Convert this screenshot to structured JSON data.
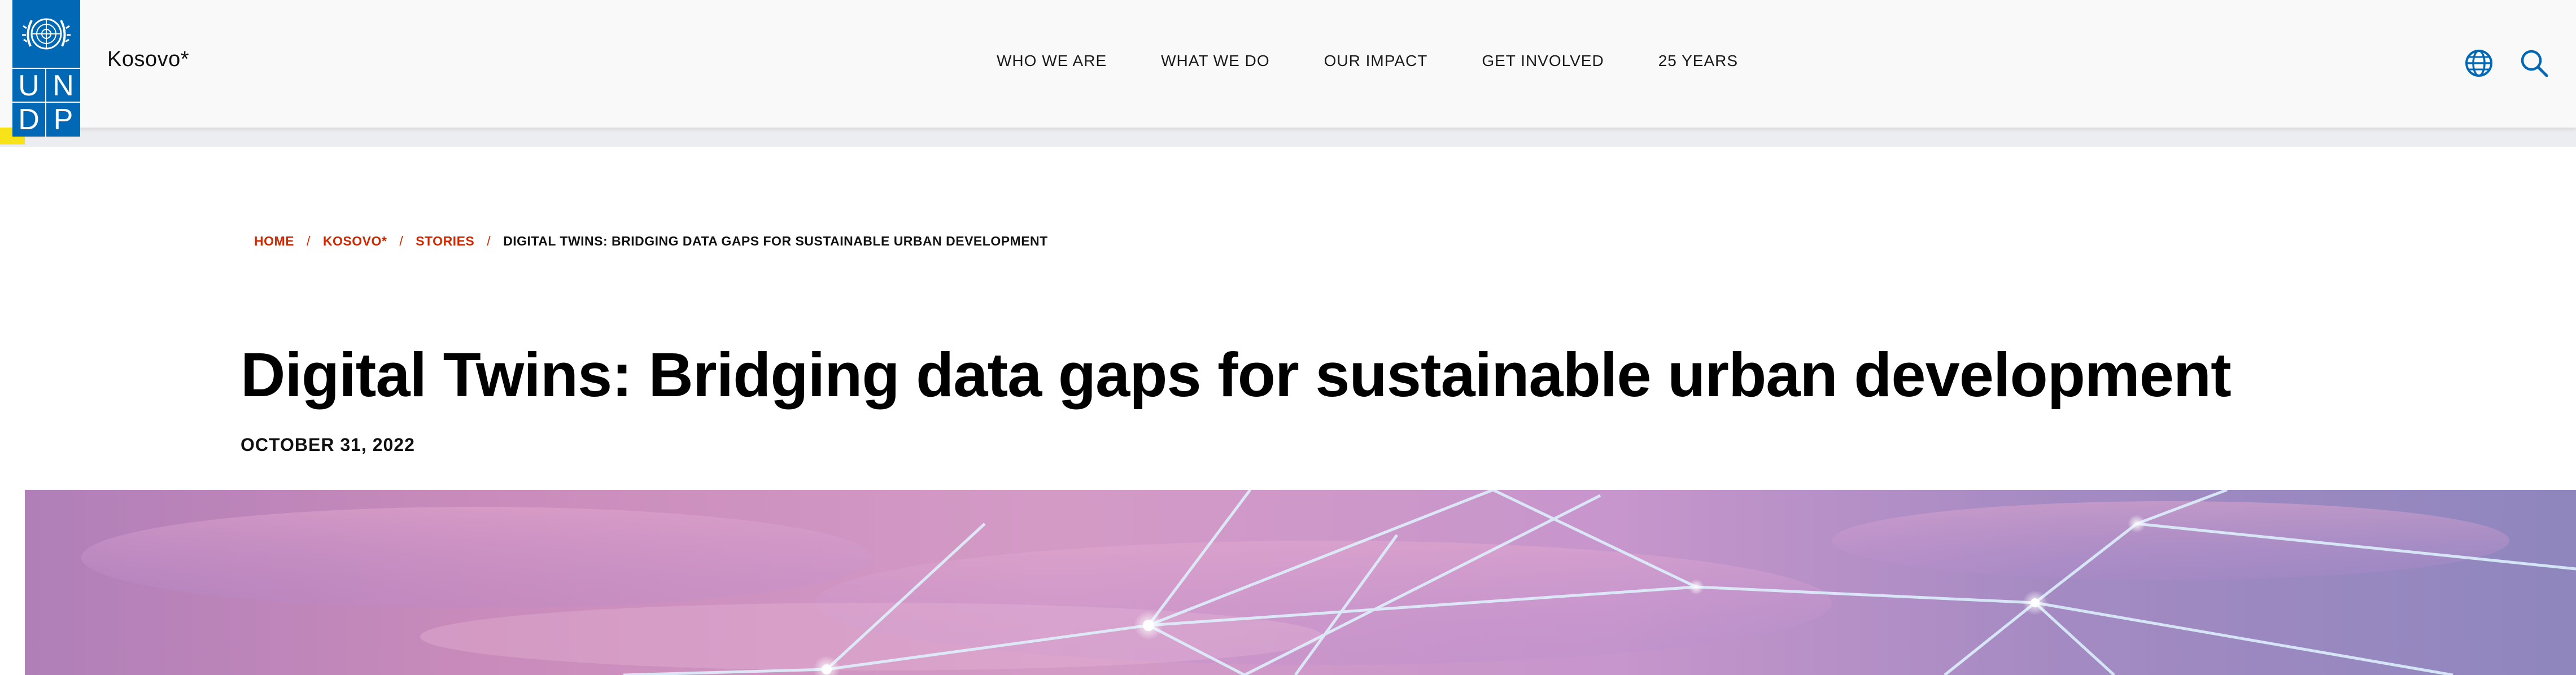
{
  "header": {
    "logo_letters": [
      "U",
      "N",
      "D",
      "P"
    ],
    "site_name": "Kosovo*",
    "nav": [
      {
        "label": "WHO WE ARE"
      },
      {
        "label": "WHAT WE DO"
      },
      {
        "label": "OUR IMPACT"
      },
      {
        "label": "GET INVOLVED"
      },
      {
        "label": "25 YEARS"
      }
    ],
    "icons": [
      "globe-icon",
      "search-icon"
    ]
  },
  "breadcrumb": {
    "items": [
      {
        "label": "HOME"
      },
      {
        "label": "KOSOVO*"
      },
      {
        "label": "STORIES"
      }
    ],
    "separator": "/",
    "current": "DIGITAL TWINS: BRIDGING DATA GAPS FOR SUSTAINABLE URBAN DEVELOPMENT"
  },
  "article": {
    "title": "Digital Twins: Bridging data gaps for sustainable urban development",
    "date": "OCTOBER 31, 2022"
  },
  "colors": {
    "brand_blue": "#0068b4",
    "breadcrumb_red": "#d12800",
    "accent_yellow": "#f8e21a"
  }
}
